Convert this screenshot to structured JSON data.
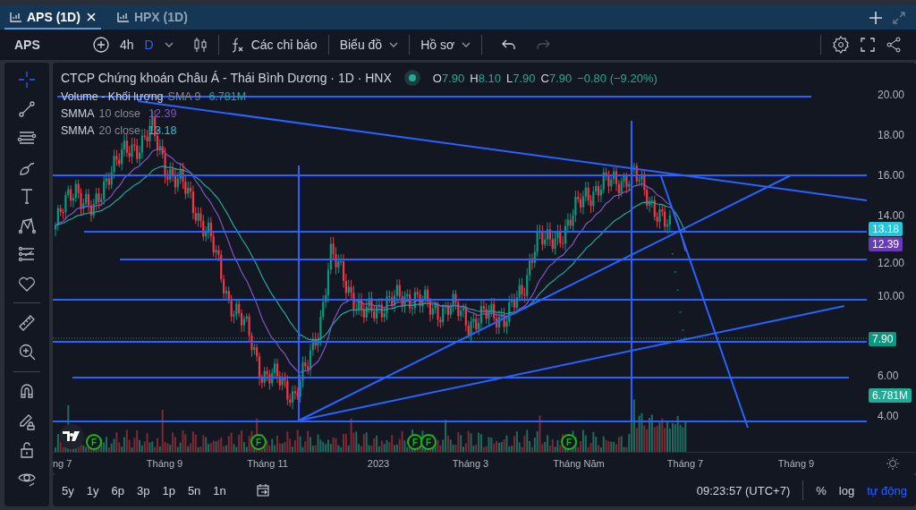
{
  "tabs": [
    {
      "label": "APS (1D)",
      "selected": true,
      "closable": true
    },
    {
      "label": "HPX (1D)",
      "selected": false,
      "closable": false
    }
  ],
  "toolbar": {
    "symbol": "APS",
    "intervals": [
      {
        "label": "4h",
        "selected": false
      },
      {
        "label": "D",
        "selected": true
      }
    ],
    "indicators": "Các chỉ báo",
    "chart_type": "Biểu đồ",
    "profile": "Hồ sơ",
    "redo_disabled": true
  },
  "legend": {
    "title": "CTCP Chứng khoán Châu Á - Thái Bình Dương · 1D · HNX",
    "ohlc": [
      {
        "label": "O",
        "value": "7.90"
      },
      {
        "label": "H",
        "value": "8.10"
      },
      {
        "label": "L",
        "value": "7.90"
      },
      {
        "label": "C",
        "value": "7.90"
      }
    ],
    "change": "−0.80 (−9.20%)",
    "indicators": [
      {
        "name": "Volume - Khối lượng",
        "param": "SMA 9",
        "value": "6.781M",
        "color": "#22ab94"
      },
      {
        "name": "SMMA",
        "param": "10 close",
        "value": "12.39",
        "color": "#7e57c2"
      },
      {
        "name": "SMMA",
        "param": "20 close",
        "value": "13.18",
        "color": "#26c6da"
      }
    ]
  },
  "left_toolbar": [
    {
      "selected": true
    },
    {
      "selected": false
    },
    {
      "selected": false
    },
    {
      "selected": false
    },
    {
      "selected": false
    },
    {
      "selected": false
    },
    {
      "selected": false
    },
    {
      "selected": false
    },
    {
      "selected": false
    },
    {
      "selected": false
    },
    {
      "selected": false
    },
    {
      "selected": false
    },
    {
      "selected": false
    },
    {
      "selected": false
    }
  ],
  "price_axis": [
    "20.00",
    "18.00",
    "16.00",
    "14.00",
    "12.00",
    "10.00",
    "6.00",
    "4.00"
  ],
  "price_tags": [
    {
      "text": "13.18",
      "color": "#26c6da"
    },
    {
      "text": "12.39",
      "color": "#673ab7"
    },
    {
      "text": "7.90",
      "color": "#089981"
    },
    {
      "text": "6.781M",
      "color": "#22ab94"
    }
  ],
  "events": [
    "F",
    "F",
    "F",
    "F",
    "F"
  ],
  "time_axis": [
    "ng 7",
    "Tháng 9",
    "Tháng 11",
    "2023",
    "Tháng 3",
    "Tháng Năm",
    "Tháng 7",
    "Tháng 9"
  ],
  "ranges": [
    "5y",
    "1y",
    "6p",
    "3p",
    "1p",
    "5n",
    "1n"
  ],
  "clock": "09:23:57 (UTC+7)",
  "scale_options": [
    {
      "label": "%",
      "selected": false
    },
    {
      "label": "log",
      "selected": false
    },
    {
      "label": "tự động",
      "selected": true
    }
  ]
}
